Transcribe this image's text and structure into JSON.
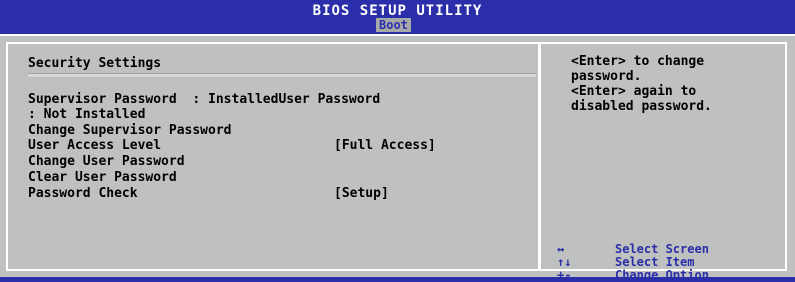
{
  "header": {
    "title": "BIOS SETUP UTILITY",
    "active_tab": "Boot"
  },
  "security": {
    "section_title": "Security Settings",
    "status_line1": "Supervisor Password  : InstalledUser Password",
    "status_line2": ": Not Installed",
    "items": [
      {
        "label": "Change Supervisor Password",
        "value": ""
      },
      {
        "label": "User Access Level",
        "value": "[Full Access]"
      },
      {
        "label": "Change User Password",
        "value": ""
      },
      {
        "label": "Clear User Password",
        "value": ""
      },
      {
        "label": "Password Check",
        "value": "[Setup]"
      }
    ]
  },
  "help": {
    "line1": "<Enter> to change",
    "line2": "password.",
    "line3": "<Enter> again to",
    "line4": "disabled password."
  },
  "keys": [
    {
      "symbol": "↔",
      "label": "Select Screen"
    },
    {
      "symbol": "↑↓",
      "label": "Select Item"
    },
    {
      "symbol": "+-",
      "label": "Change Option"
    }
  ],
  "colors": {
    "bios_blue": "#2a2ea8",
    "panel_gray": "#bfc0c0",
    "tab_gray": "#a7a8a8",
    "text": "#000000"
  }
}
